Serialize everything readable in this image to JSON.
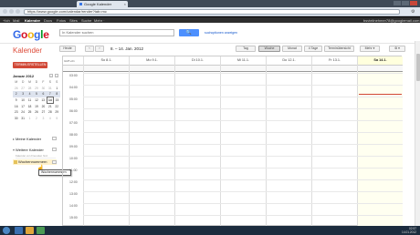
{
  "browser": {
    "tab_title": "Google Kalender",
    "tab_close": "×",
    "url": "https://www.google.com/calendar/render?tab=mc",
    "wrench": "⚙"
  },
  "gbar": {
    "items": [
      "+Ich",
      "Mail",
      "Kalender",
      "Docs",
      "Fotos",
      "Sites",
      "Suche",
      "Mehr ·"
    ],
    "active_index": 2,
    "account": "bsvteilnehmer78@googlemail.com"
  },
  "header": {
    "logo": [
      "G",
      "o",
      "o",
      "g",
      "l",
      "e"
    ],
    "search_placeholder": "In Kalender suchen",
    "search_button": "🔍",
    "search_options": "suchoptionen anzeigen"
  },
  "toolbar": {
    "app_title": "Kalender",
    "today": "Heute",
    "prev": "‹",
    "next": "›",
    "date_range": "8. – 14. Jan. 2012",
    "views": [
      "Tag",
      "Woche",
      "Monat",
      "4 Tage",
      "Terminübersicht"
    ],
    "selected_view": 1,
    "more": "Mehr ▾",
    "settings": "⚙ ▾"
  },
  "sidebar": {
    "create_button": "TERMIN ERSTELLEN",
    "mini_month": "Januar 2012",
    "mini_prev": "‹",
    "mini_next": "›",
    "weekdays": [
      "M",
      "D",
      "M",
      "D",
      "F",
      "S",
      "S"
    ],
    "weeks": [
      [
        "26",
        "27",
        "28",
        "29",
        "30",
        "31",
        "1"
      ],
      [
        "2",
        "3",
        "4",
        "5",
        "6",
        "7",
        "8"
      ],
      [
        "9",
        "10",
        "11",
        "12",
        "13",
        "14",
        "15"
      ],
      [
        "16",
        "17",
        "18",
        "19",
        "20",
        "21",
        "22"
      ],
      [
        "23",
        "24",
        "25",
        "26",
        "27",
        "28",
        "29"
      ],
      [
        "30",
        "31",
        "1",
        "2",
        "3",
        "4",
        "5"
      ]
    ],
    "my_calendars": "Meine Kalender",
    "other_calendars": "Weitere Kalender",
    "add_friend_placeholder": "Kalender von Freunden hinz",
    "calendar_item": "Wochennummern",
    "tooltip": "Wochennummern"
  },
  "calendar": {
    "timezone": "GMT+01",
    "days": [
      "So 8.1.",
      "Mo 9.1.",
      "Di 10.1.",
      "Mi 11.1.",
      "Do 12.1.",
      "Fr 13.1.",
      "Sa 14.1."
    ],
    "times": [
      "03:00",
      "04:00",
      "05:00",
      "06:00",
      "07:00",
      "08:00",
      "09:00",
      "10:00",
      "11:00",
      "12:00",
      "13:00",
      "14:00",
      "15:00"
    ]
  },
  "taskbar": {
    "time": "02:57",
    "date": "14.01.2012"
  },
  "colors": {
    "accent": "#d14836",
    "brand_blue": "#4d90fe",
    "calendar_swatch": "#e6c35c"
  }
}
